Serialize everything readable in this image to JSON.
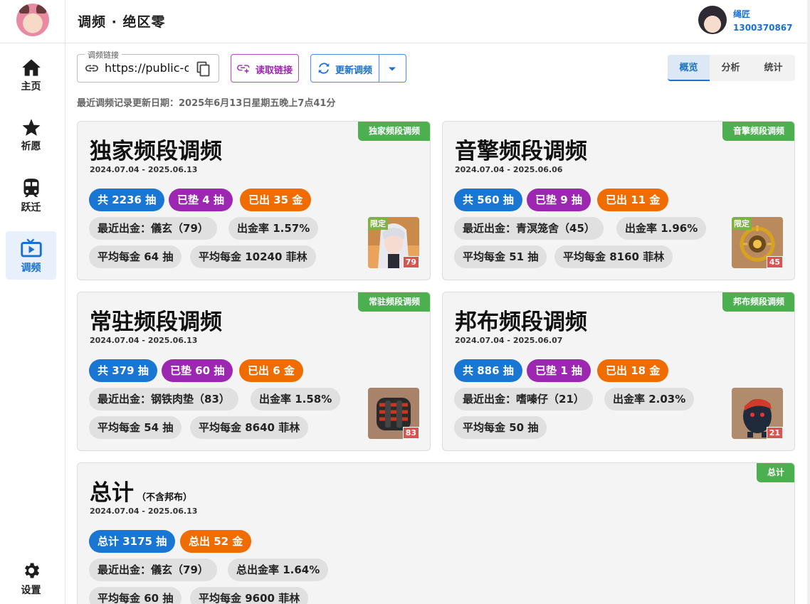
{
  "header": {
    "title": "调频 · 绝区零",
    "user_name": "绳匠",
    "user_id": "1300370867"
  },
  "sidebar": {
    "items": [
      {
        "label": "主页",
        "icon": "home-icon"
      },
      {
        "label": "祈愿",
        "icon": "star-icon"
      },
      {
        "label": "跃迁",
        "icon": "train-icon"
      },
      {
        "label": "调频",
        "icon": "tv-icon",
        "active": true
      }
    ],
    "settings_label": "设置"
  },
  "toolbar": {
    "link_legend": "调频链接",
    "link_value": "https://public-operation-nap.mihoyo.com",
    "read_label": "读取链接",
    "update_label": "更新调频"
  },
  "view_tabs": [
    "概览",
    "分析",
    "统计"
  ],
  "update_date": "最近调频记录更新日期：2025年6月13日星期五晚上7点41分",
  "cards": [
    {
      "tag": "独家频段调频",
      "title": "独家频段调频",
      "range": "2024.07.04 - 2025.06.13",
      "total": "共 2236 抽",
      "pity": "已垫 4 抽",
      "gold": "已出 35 金",
      "latest": "最近出金：儀玄（79）",
      "rate": "出金率 1.57%",
      "avg_pulls": "平均每金 64 抽",
      "avg_film": "平均每金 10240 菲林",
      "thumb_badge": "限定",
      "thumb_count": "79"
    },
    {
      "tag": "音擎频段调频",
      "title": "音擎频段调频",
      "range": "2024.07.04 - 2025.06.06",
      "total": "共 560 抽",
      "pity": "已垫 9 抽",
      "gold": "已出 11 金",
      "latest": "最近出金：青溟笼舍（45）",
      "rate": "出金率 1.96%",
      "avg_pulls": "平均每金 51 抽",
      "avg_film": "平均每金 8160 菲林",
      "thumb_badge": "限定",
      "thumb_count": "45"
    },
    {
      "tag": "常驻频段调频",
      "title": "常驻频段调频",
      "range": "2024.07.04 - 2025.06.13",
      "total": "共 379 抽",
      "pity": "已垫 60 抽",
      "gold": "已出 6 金",
      "latest": "最近出金：钢铁肉垫（83）",
      "rate": "出金率 1.58%",
      "avg_pulls": "平均每金 54 抽",
      "avg_film": "平均每金 8640 菲林",
      "thumb_count": "83"
    },
    {
      "tag": "邦布频段调频",
      "title": "邦布频段调频",
      "range": "2024.07.04 - 2025.06.07",
      "total": "共 886 抽",
      "pity": "已垫 1 抽",
      "gold": "已出 18 金",
      "latest": "最近出金：嗜嗪仔（21）",
      "rate": "出金率 2.03%",
      "avg_pulls": "平均每金 50 抽",
      "thumb_count": "21"
    }
  ],
  "summary": {
    "tag": "总计",
    "title": "总计",
    "subtitle": "（不含邦布）",
    "range": "2024.07.04 - 2025.06.13",
    "total": "总计 3175 抽",
    "gold": "总出 52 金",
    "latest": "最近出金：儀玄（79）",
    "rate": "总出金率 1.64%",
    "avg_pulls": "平均每金 60 抽",
    "avg_film": "平均每金 9600 菲林"
  },
  "colors": {
    "accent": "#1976d2",
    "purple": "#9c27b0",
    "orange": "#ef6c00",
    "tag_green": "#4caf50",
    "card_bg": "#f4f4f4"
  }
}
